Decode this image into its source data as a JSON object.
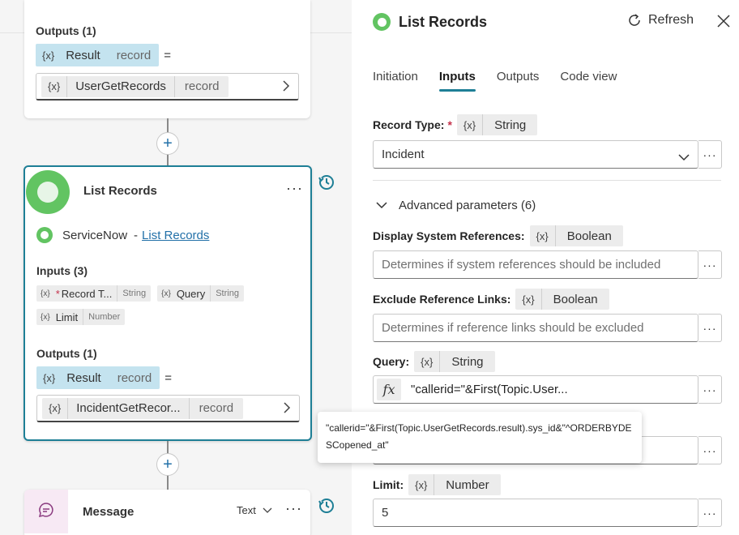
{
  "canvas": {
    "top_node": {
      "outputs_label": "Outputs (1)",
      "result_chip": {
        "icon": "{x}",
        "name": "Result",
        "type": "record"
      },
      "equals": "=",
      "assigned_var": {
        "icon": "{x}",
        "name": "UserGetRecords",
        "type": "record"
      }
    },
    "list_node": {
      "title": "List Records",
      "connector_name": "ServiceNow",
      "separator": "-",
      "connector_link": "List Records",
      "inputs_label": "Inputs (3)",
      "inputs": [
        {
          "icon": "{x}",
          "required": "*",
          "name": "Record T...",
          "type": "String"
        },
        {
          "icon": "{x}",
          "required": "",
          "name": "Query",
          "type": "String"
        },
        {
          "icon": "{x}",
          "required": "",
          "name": "Limit",
          "type": "Number"
        }
      ],
      "outputs_label": "Outputs (1)",
      "result_chip": {
        "icon": "{x}",
        "name": "Result",
        "type": "record"
      },
      "equals": "=",
      "assigned_var": {
        "icon": "{x}",
        "name": "IncidentGetRecor...",
        "type": "record"
      }
    },
    "message_node": {
      "title": "Message",
      "mode": "Text"
    }
  },
  "panel": {
    "title": "List Records",
    "refresh_label": "Refresh",
    "tabs": [
      {
        "label": "Initiation",
        "active": false
      },
      {
        "label": "Inputs",
        "active": true
      },
      {
        "label": "Outputs",
        "active": false
      },
      {
        "label": "Code view",
        "active": false
      }
    ],
    "record_type": {
      "label": "Record Type:",
      "required": "*",
      "icon": "{x}",
      "type": "String",
      "value": "Incident"
    },
    "advanced_label": "Advanced parameters (6)",
    "display_refs": {
      "label": "Display System References:",
      "icon": "{x}",
      "type": "Boolean",
      "placeholder": "Determines if system references should be included"
    },
    "exclude_links": {
      "label": "Exclude Reference Links:",
      "icon": "{x}",
      "type": "Boolean",
      "placeholder": "Determines if reference links should be excluded"
    },
    "query": {
      "label": "Query:",
      "icon": "{x}",
      "type": "String",
      "fx": "fx",
      "value": "\"callerid=\"&First(Topic.User..."
    },
    "limit": {
      "label": "Limit:",
      "icon": "{x}",
      "type": "Number",
      "value": "5"
    },
    "tooltip": "\"callerid=\"&First(Topic.UserGetRecords.result).sys_id&\"^ORDERBYDESCopened_at\""
  },
  "colors": {
    "accent": "#1e7f96",
    "logo": "#62c462",
    "chip": "#c4e3ef",
    "required": "#c4314b",
    "link": "#2270a8"
  }
}
